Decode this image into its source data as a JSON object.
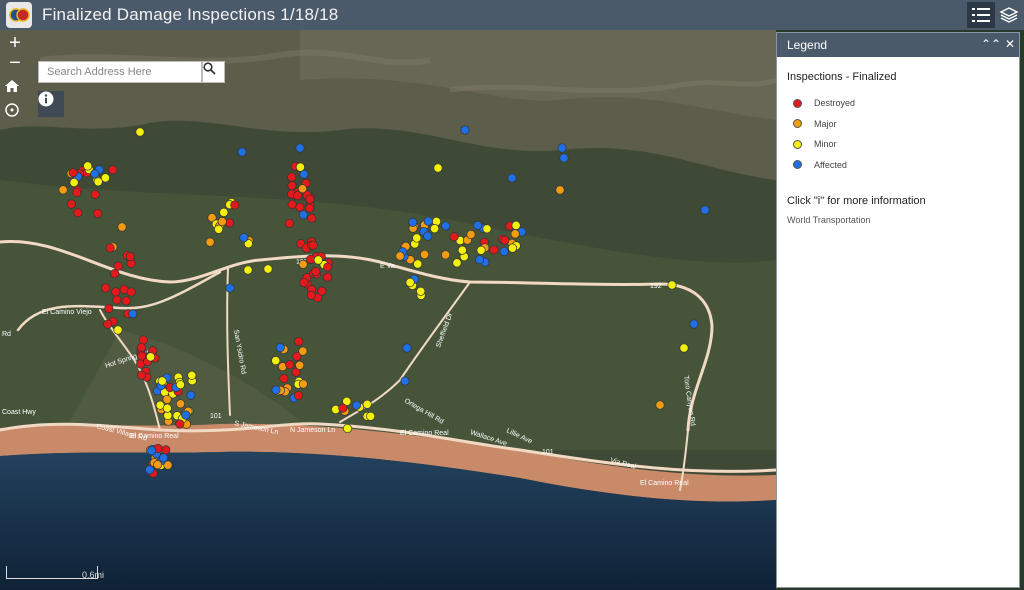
{
  "header": {
    "title": "Finalized Damage Inspections 1/18/18"
  },
  "toolbar": {
    "legend_icon": "list-icon",
    "layers_icon": "layers-icon"
  },
  "search": {
    "placeholder": "Search Address Here"
  },
  "zoom": {
    "in_label": "+",
    "out_label": "−"
  },
  "scale": {
    "label": "0.6mi"
  },
  "map_labels": {
    "el_camino_viejo": "El Camino Viejo",
    "east_valley": "E Va...",
    "hwy192": "192",
    "hwy192b": "192",
    "san_ysidro": "San Ysidro Rd",
    "hot_springs": "Hot Springs Rd",
    "sheffield": "Sheffield Dr",
    "toro_canyon": "Toro Canyon Rd",
    "coast_hwy": "Coast Hwy",
    "coast_village": "Coast Village Rd",
    "el_camino_real_1": "El Camino Real",
    "el_camino_real_2": "El Camino Real",
    "el_camino_real_3": "El Camino Real",
    "s_jameson": "S Jameson Ln",
    "n_jameson": "N Jameson Ln",
    "ortega_hill": "Ortega Hill Rd",
    "wallace": "Wallace Ave",
    "lillie": "Lillie Ave",
    "via_real": "Via Real",
    "rd": "Rd",
    "hwy101a": "101",
    "hwy101b": "101"
  },
  "legend": {
    "title": "Legend",
    "layer_title": "Inspections - Finalized",
    "items": [
      {
        "label": "Destroyed",
        "color": "#e31a1c"
      },
      {
        "label": "Major",
        "color": "#f39c12"
      },
      {
        "label": "Minor",
        "color": "#f4f00e"
      },
      {
        "label": "Affected",
        "color": "#1f6fe5"
      }
    ],
    "click_note": "Click \"i\" for more information",
    "transport": "World Transportation"
  }
}
